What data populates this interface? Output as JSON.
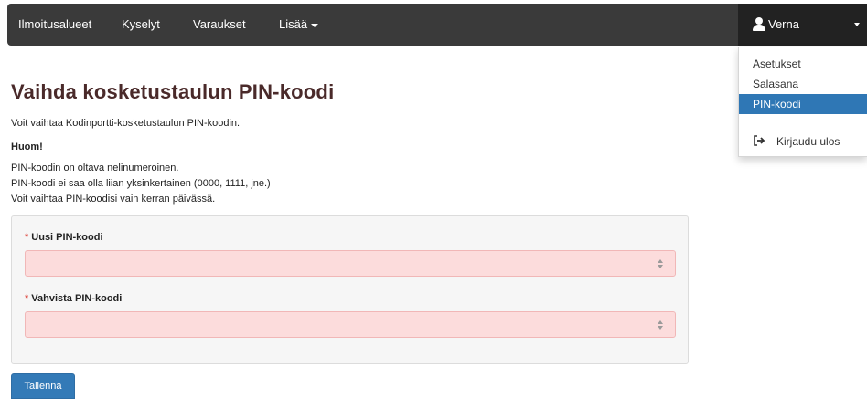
{
  "navbar": {
    "items": [
      {
        "label": "Ilmoitusalueet"
      },
      {
        "label": "Kyselyt"
      },
      {
        "label": "Varaukset"
      },
      {
        "label": "Lisää"
      }
    ],
    "user": {
      "name": "Verna",
      "icon": "user-icon"
    }
  },
  "user_menu": {
    "items": [
      {
        "label": "Asetukset",
        "active": false
      },
      {
        "label": "Salasana",
        "active": false
      },
      {
        "label": "PIN-koodi",
        "active": true
      }
    ],
    "logout": {
      "label": "Kirjaudu ulos",
      "icon": "sign-out-icon"
    },
    "active_color": "#2f77b5"
  },
  "page": {
    "title": "Vaihda kosketustaulun PIN-koodi",
    "intro": "Voit vaihtaa Kodinportti-kosketustaulun PIN-koodin.",
    "note_heading": "Huom!",
    "notes": [
      "PIN-koodin on oltava nelinumeroinen.",
      "PIN-koodi ei saa olla liian yksinkertainen (0000, 1111, jne.)",
      "Voit vaihtaa PIN-koodisi vain kerran päivässä."
    ]
  },
  "form": {
    "required_marker": "*",
    "new_pin": {
      "label": "Uusi PIN-koodi",
      "value": "",
      "placeholder": ""
    },
    "confirm_pin": {
      "label": "Vahvista PIN-koodi",
      "value": "",
      "placeholder": ""
    },
    "submit_label": "Tallenna"
  },
  "colors": {
    "navbar_bg": "#3a3a3a",
    "user_bg": "#222222",
    "title": "#4a2a2a",
    "input_error_bg": "#fcdcdc",
    "button": "#337ab7",
    "required": "#d9261c"
  }
}
